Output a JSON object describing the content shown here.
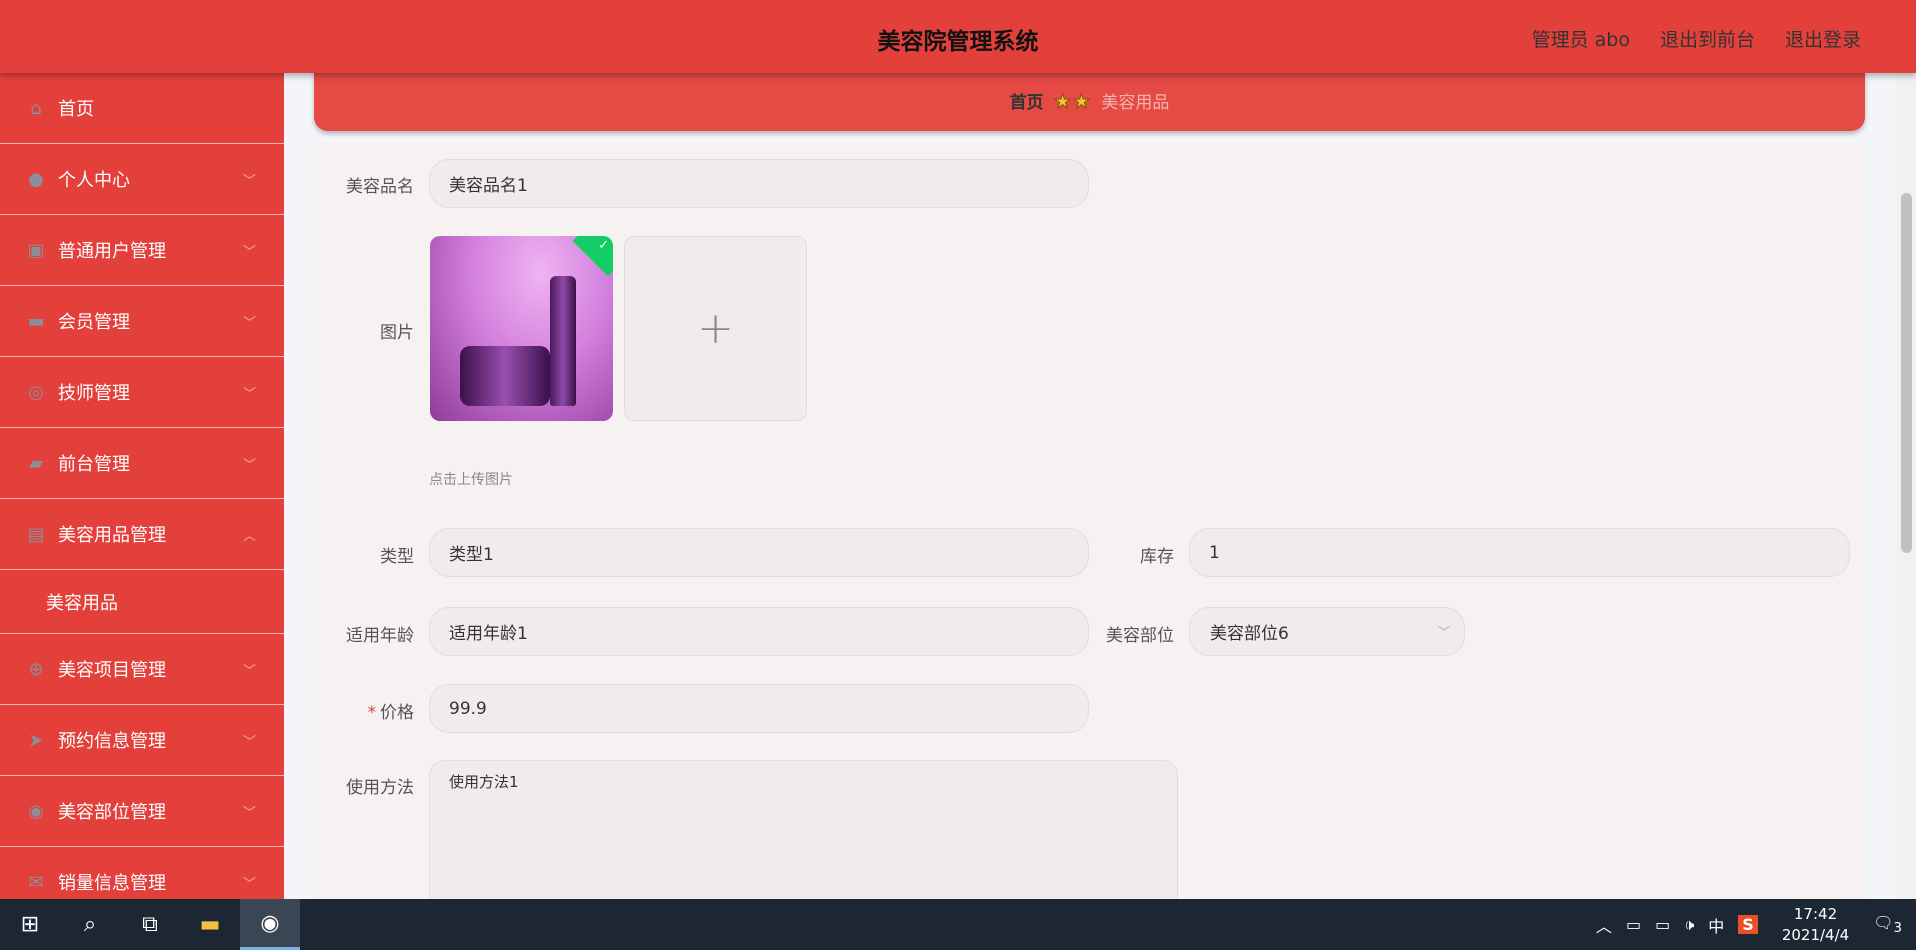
{
  "header": {
    "title": "美容院管理系统",
    "user": "管理员 abo",
    "front": "退出到前台",
    "logout": "退出登录"
  },
  "sidebar": {
    "items": [
      {
        "label": "首页",
        "icon": "home-icon",
        "glyph": "⌂"
      },
      {
        "label": "个人中心",
        "icon": "user-icon",
        "glyph": "●"
      },
      {
        "label": "普通用户管理",
        "icon": "clipboard-icon",
        "glyph": "▣"
      },
      {
        "label": "会员管理",
        "icon": "briefcase-icon",
        "glyph": "▬"
      },
      {
        "label": "技师管理",
        "icon": "gauge-icon",
        "glyph": "◎"
      },
      {
        "label": "前台管理",
        "icon": "wallet-icon",
        "glyph": "▰"
      },
      {
        "label": "美容用品管理",
        "icon": "document-icon",
        "glyph": "▤"
      }
    ],
    "sub": "美容用品",
    "items2": [
      {
        "label": "美容项目管理",
        "icon": "aim-icon",
        "glyph": "⊕"
      },
      {
        "label": "预约信息管理",
        "icon": "navigation-icon",
        "glyph": "➤"
      },
      {
        "label": "美容部位管理",
        "icon": "lifebuoy-icon",
        "glyph": "◉"
      },
      {
        "label": "销量信息管理",
        "icon": "message-icon",
        "glyph": "✉"
      }
    ]
  },
  "breadcrumb": {
    "home": "首页",
    "stars": "★★",
    "current": "美容用品"
  },
  "form": {
    "name_label": "美容品名",
    "name": "美容品名1",
    "image_label": "图片",
    "upload_hint": "点击上传图片",
    "plus": "+",
    "check": "✓",
    "type_label": "类型",
    "type": "类型1",
    "stock_label": "库存",
    "stock": "1",
    "age_label": "适用年龄",
    "age": "适用年龄1",
    "part_label": "美容部位",
    "part": "美容部位6",
    "price_required": "*",
    "price_label": "价格",
    "price": "99.9",
    "usage_label": "使用方法",
    "usage": "使用方法1"
  },
  "taskbar": {
    "time": "17:42",
    "date": "2021/4/4",
    "ime": "中",
    "notifications": "3",
    "sogou": "S"
  }
}
